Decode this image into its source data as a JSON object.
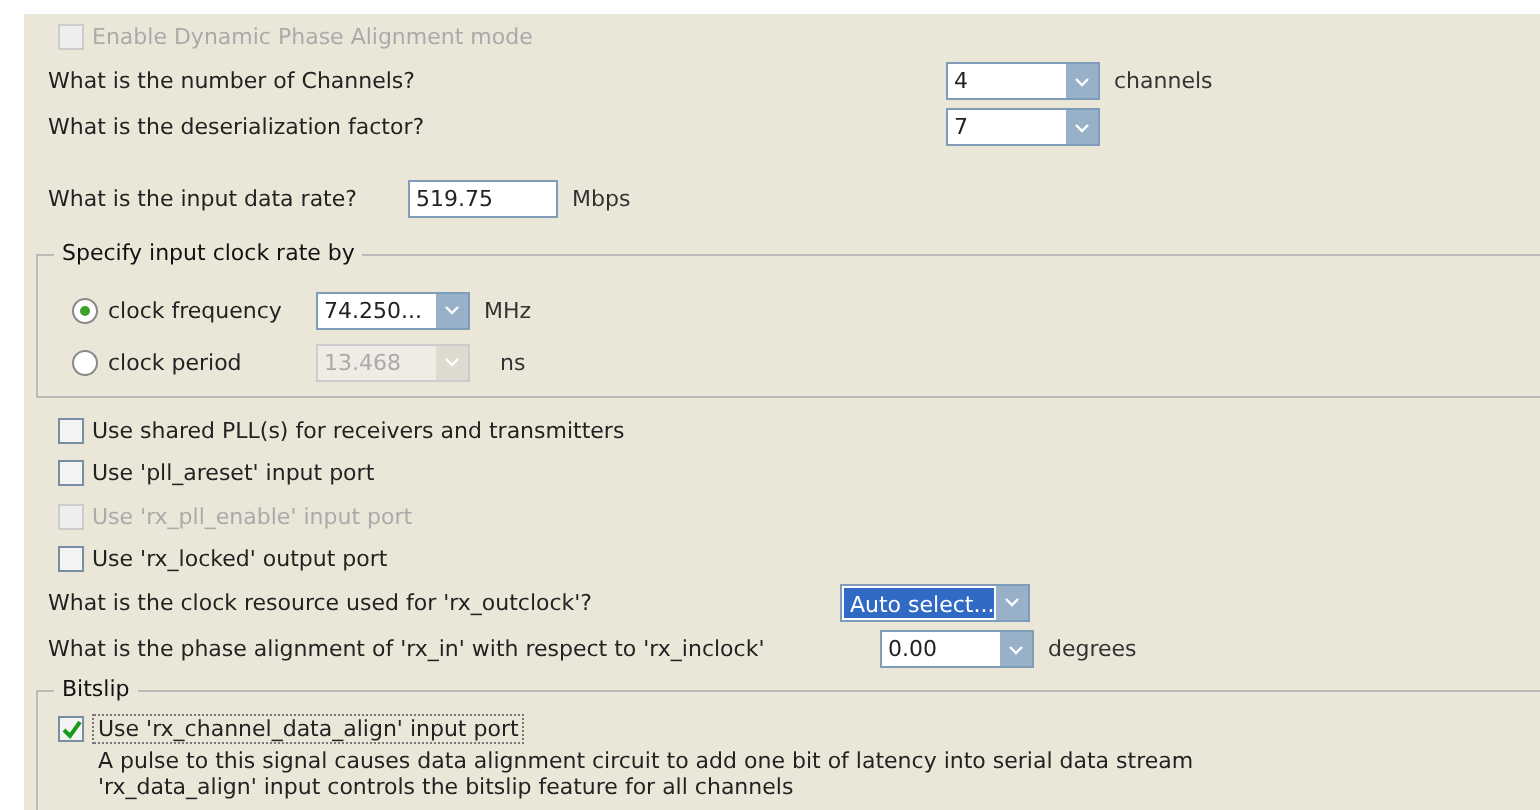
{
  "dynamic_phase_alignment": {
    "label": "Enable Dynamic Phase Alignment mode",
    "checked": false,
    "disabled": true
  },
  "questions": [
    {
      "label": "What is the number of Channels?",
      "value": "4",
      "unit": "channels"
    },
    {
      "label": "What is the deserialization factor?",
      "value": "7"
    }
  ],
  "data_rate": {
    "label": "What is the input data rate?",
    "value": "519.75",
    "unit": "Mbps"
  },
  "clock_group": {
    "title": "Specify input clock rate by",
    "options": [
      {
        "label": "clock frequency",
        "selected": true,
        "value": "74.250...",
        "unit": "MHz",
        "disabled": false
      },
      {
        "label": "clock period",
        "selected": false,
        "value": "13.468",
        "unit": "ns",
        "disabled": true
      }
    ]
  },
  "checkboxes": [
    {
      "label": "Use shared PLL(s) for receivers and transmitters",
      "checked": false,
      "disabled": false
    },
    {
      "label": "Use 'pll_areset' input port",
      "checked": false,
      "disabled": false
    },
    {
      "label": "Use 'rx_pll_enable' input port",
      "checked": false,
      "disabled": true
    },
    {
      "label": "Use 'rx_locked' output port",
      "checked": false,
      "disabled": false
    }
  ],
  "clock_resource": {
    "label": "What is the clock resource used for 'rx_outclock'?",
    "value": "Auto select...",
    "selected": true
  },
  "phase_alignment": {
    "label": "What is the phase alignment of 'rx_in' with respect to 'rx_inclock'",
    "value": "0.00",
    "unit": "degrees"
  },
  "bitslip": {
    "title": "Bitslip",
    "checkbox": {
      "label": "Use 'rx_channel_data_align' input port",
      "checked": true,
      "disabled": false
    },
    "description": [
      "A pulse to this signal causes data alignment circuit to add one bit of latency into serial data stream",
      "'rx_data_align' input controls the bitslip feature for all channels"
    ]
  }
}
